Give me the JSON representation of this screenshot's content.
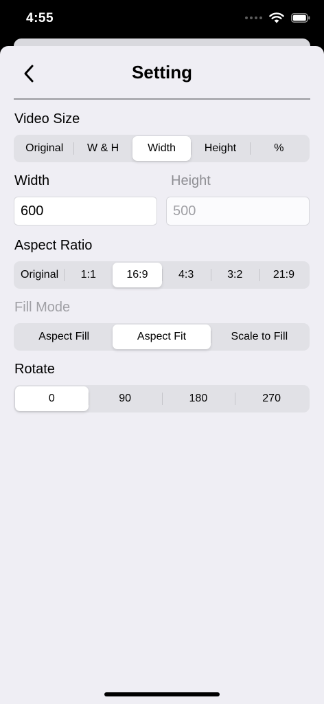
{
  "status_bar": {
    "time": "4:55"
  },
  "nav": {
    "title": "Setting"
  },
  "video_size": {
    "label": "Video Size",
    "options": [
      "Original",
      "W & H",
      "Width",
      "Height",
      "%"
    ],
    "selected": "Width"
  },
  "dimensions": {
    "width_label": "Width",
    "width_value": "600",
    "height_label": "Height",
    "height_value": "500"
  },
  "aspect_ratio": {
    "label": "Aspect Ratio",
    "options": [
      "Original",
      "1:1",
      "16:9",
      "4:3",
      "3:2",
      "21:9"
    ],
    "selected": "16:9"
  },
  "fill_mode": {
    "label": "Fill Mode",
    "options": [
      "Aspect Fill",
      "Aspect Fit",
      "Scale to Fill"
    ],
    "selected": "Aspect Fit"
  },
  "rotate": {
    "label": "Rotate",
    "options": [
      "0",
      "90",
      "180",
      "270"
    ],
    "selected": "0"
  }
}
